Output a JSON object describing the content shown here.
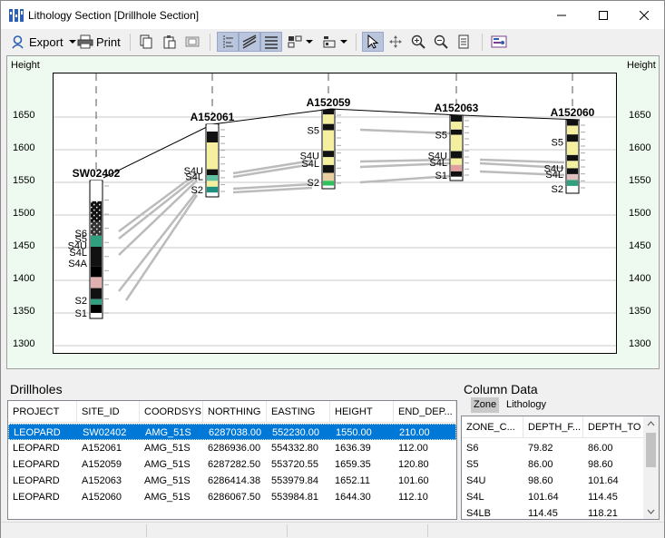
{
  "window": {
    "title": "Lithology Section [Drillhole Section]",
    "minimize_icon": "minimize-icon",
    "maximize_icon": "maximize-icon",
    "close_icon": "close-icon"
  },
  "toolbar": {
    "export_label": "Export",
    "print_label": "Print"
  },
  "chart": {
    "left_axis_title": "Height",
    "right_axis_title": "Height",
    "y_ticks": [
      "1650",
      "1600",
      "1550",
      "1500",
      "1450",
      "1400",
      "1350",
      "1300"
    ]
  },
  "chart_data": {
    "type": "section",
    "y_axis_label": "Height",
    "y_range": [
      1280,
      1690
    ],
    "holes": [
      {
        "id": "SW02402",
        "height": 1550.0,
        "end_depth": 210.0,
        "zones": [
          "S6",
          "S5",
          "S4U",
          "S4L",
          "S4A",
          "S2",
          "S1"
        ]
      },
      {
        "id": "A152061",
        "height": 1636.39,
        "end_depth": 112.0,
        "zones": [
          "S4U",
          "S4L",
          "S2"
        ]
      },
      {
        "id": "A152059",
        "height": 1659.35,
        "end_depth": 120.8,
        "zones": [
          "S5",
          "S4U",
          "S4L",
          "S2"
        ]
      },
      {
        "id": "A152063",
        "height": 1652.11,
        "end_depth": 101.6,
        "zones": [
          "S5",
          "S4U",
          "S4L",
          "S1"
        ]
      },
      {
        "id": "A152060",
        "height": 1644.3,
        "end_depth": 112.1,
        "zones": [
          "S5",
          "S4U",
          "S4L",
          "S2"
        ]
      }
    ]
  },
  "drillholes": {
    "title": "Drillholes",
    "columns": [
      "PROJECT",
      "SITE_ID",
      "COORDSYS",
      "NORTHING",
      "EASTING",
      "HEIGHT",
      "END_DEP..."
    ],
    "rows": [
      [
        "LEOPARD",
        "SW02402",
        "AMG_51S",
        "6287038.00",
        "552230.00",
        "1550.00",
        "210.00"
      ],
      [
        "LEOPARD",
        "A152061",
        "AMG_51S",
        "6286936.00",
        "554332.80",
        "1636.39",
        "112.00"
      ],
      [
        "LEOPARD",
        "A152059",
        "AMG_51S",
        "6287282.50",
        "553720.55",
        "1659.35",
        "120.80"
      ],
      [
        "LEOPARD",
        "A152063",
        "AMG_51S",
        "6286414.38",
        "553979.84",
        "1652.11",
        "101.60"
      ],
      [
        "LEOPARD",
        "A152060",
        "AMG_51S",
        "6286067.50",
        "553984.81",
        "1644.30",
        "112.10"
      ]
    ]
  },
  "column_data": {
    "title": "Column Data",
    "tabs": [
      "Zone",
      "Lithology"
    ],
    "columns": [
      "ZONE_C...",
      "DEPTH_F...",
      "DEPTH_TO"
    ],
    "rows": [
      [
        "S6",
        "79.82",
        "86.00"
      ],
      [
        "S5",
        "86.00",
        "98.60"
      ],
      [
        "S4U",
        "98.60",
        "101.64"
      ],
      [
        "S4L",
        "101.64",
        "114.45"
      ],
      [
        "S4LB",
        "114.45",
        "118.21"
      ]
    ]
  }
}
